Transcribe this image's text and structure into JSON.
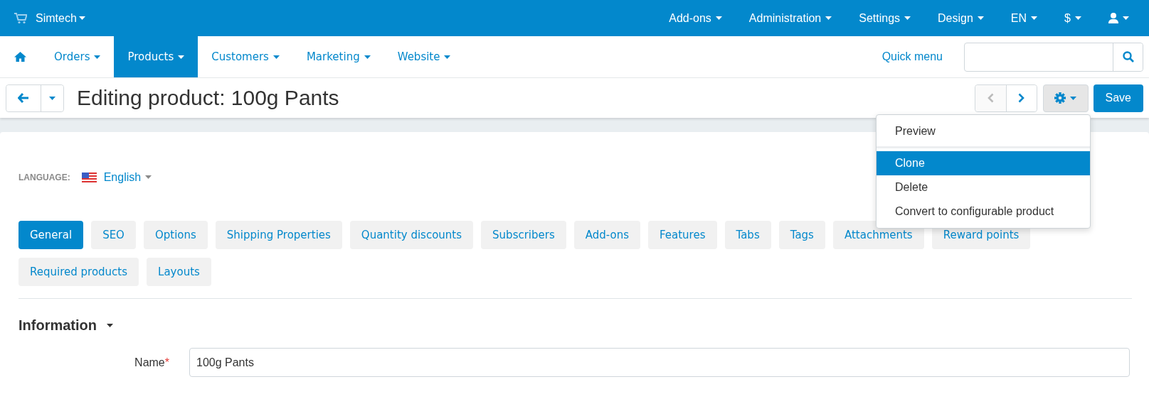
{
  "top_bar": {
    "store": "Simtech",
    "menus": [
      {
        "label": "Add-ons"
      },
      {
        "label": "Administration"
      },
      {
        "label": "Settings"
      },
      {
        "label": "Design"
      },
      {
        "label": "EN"
      },
      {
        "label": "$"
      }
    ]
  },
  "nav": {
    "items": [
      {
        "label": "Orders",
        "selected": false
      },
      {
        "label": "Products",
        "selected": true
      },
      {
        "label": "Customers",
        "selected": false
      },
      {
        "label": "Marketing",
        "selected": false
      },
      {
        "label": "Website",
        "selected": false
      }
    ],
    "quick_menu": "Quick menu"
  },
  "toolbar": {
    "title": "Editing product: 100g Pants",
    "prev_disabled": true,
    "next_disabled": false,
    "save": "Save"
  },
  "dropdown": {
    "items": [
      {
        "label": "Preview",
        "selected": false,
        "divider_after": true
      },
      {
        "label": "Clone",
        "selected": true,
        "divider_after": false
      },
      {
        "label": "Delete",
        "selected": false,
        "divider_after": false
      },
      {
        "label": "Convert to configurable product",
        "selected": false,
        "divider_after": false
      }
    ]
  },
  "language": {
    "label": "LANGUAGE:",
    "value": "English"
  },
  "tabs": [
    {
      "label": "General",
      "selected": true
    },
    {
      "label": "SEO",
      "selected": false
    },
    {
      "label": "Options",
      "selected": false
    },
    {
      "label": "Shipping Properties",
      "selected": false
    },
    {
      "label": "Quantity discounts",
      "selected": false
    },
    {
      "label": "Subscribers",
      "selected": false
    },
    {
      "label": "Add-ons",
      "selected": false
    },
    {
      "label": "Features",
      "selected": false
    },
    {
      "label": "Tabs",
      "selected": false
    },
    {
      "label": "Tags",
      "selected": false
    },
    {
      "label": "Attachments",
      "selected": false
    },
    {
      "label": "Reward points",
      "selected": false
    },
    {
      "label": "Required products",
      "selected": false
    },
    {
      "label": "Layouts",
      "selected": false
    }
  ],
  "section": {
    "title": "Information"
  },
  "field": {
    "label": "Name",
    "required": true,
    "required_mark": "*",
    "value": "100g Pants"
  }
}
